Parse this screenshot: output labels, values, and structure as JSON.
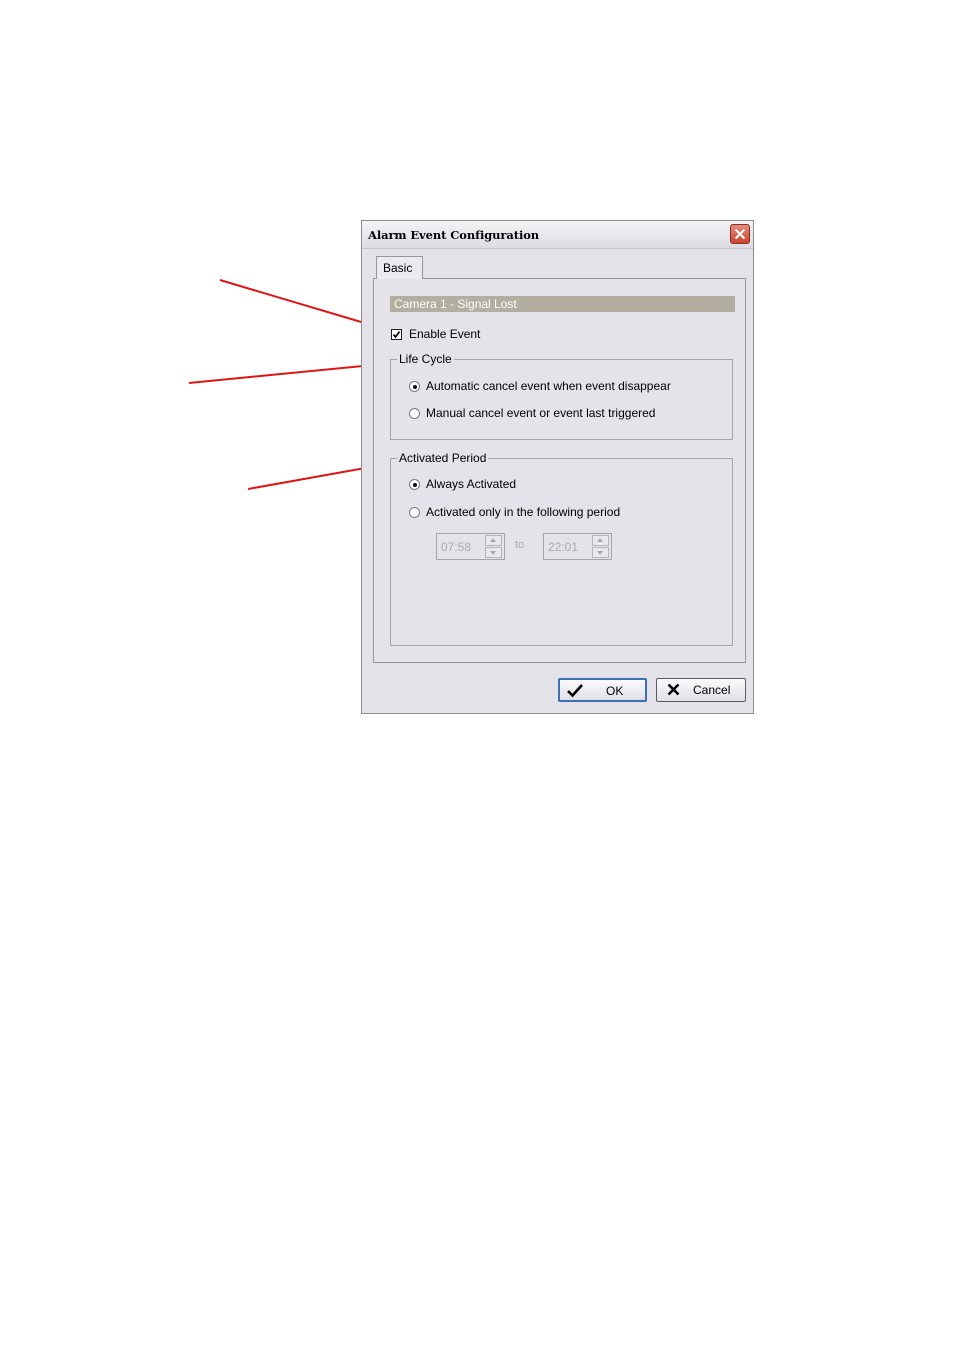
{
  "dialog": {
    "title": "Alarm Event Configuration",
    "tabs": [
      {
        "label": "Basic",
        "selected": true
      }
    ],
    "event_name": "Camera 1 - Signal Lost",
    "enable_event": {
      "label": "Enable Event",
      "checked": true
    },
    "life_cycle": {
      "legend": "Life Cycle",
      "options": [
        {
          "label": "Automatic cancel event when event disappear",
          "selected": true
        },
        {
          "label": "Manual cancel event or event last triggered",
          "selected": false
        }
      ]
    },
    "activated_period": {
      "legend": "Activated Period",
      "options": [
        {
          "label": "Always Activated",
          "selected": true
        },
        {
          "label": "Activated only in the following period",
          "selected": false
        }
      ],
      "start_time": "07:58",
      "to_label": "to",
      "end_time": "22:01"
    },
    "buttons": {
      "ok": "OK",
      "cancel": "Cancel"
    }
  },
  "colors": {
    "annotation_line": "#e01414",
    "event_bar": "#b3ae9f",
    "dialog_bg": "#e3e2e9",
    "close_button": "#c9442f",
    "default_button_border": "#3d6fb5"
  },
  "icons": {
    "close": "close-x-icon",
    "ok": "checkmark-icon",
    "cancel": "x-mark-icon"
  }
}
